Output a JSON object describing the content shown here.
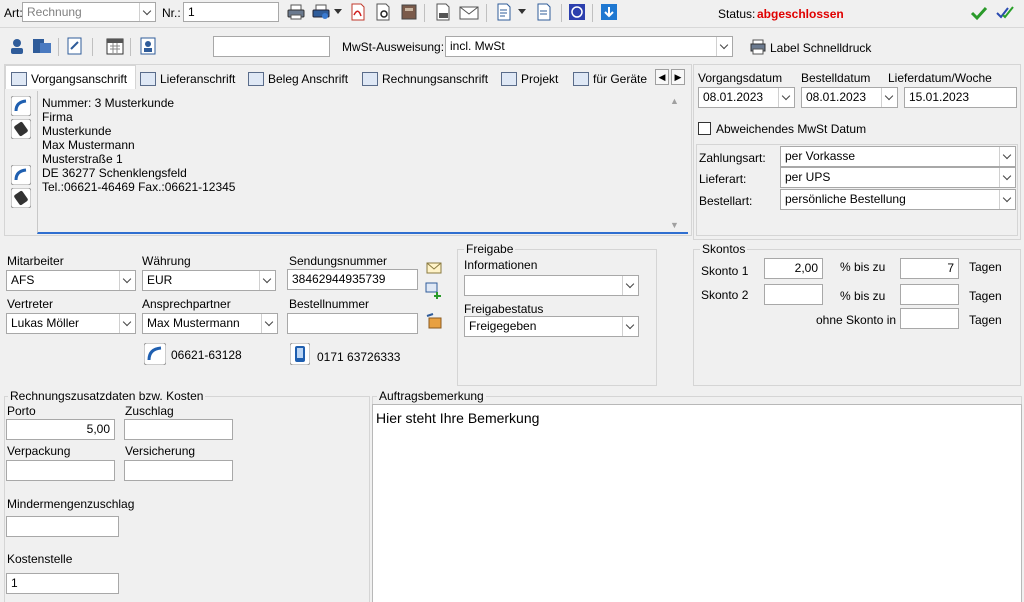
{
  "toolbar": {
    "art_label": "Art:",
    "art_value": "Rechnung",
    "nr_label": "Nr.:",
    "nr_value": "1",
    "status_label": "Status:",
    "status_value": "abgeschlossen",
    "status_color": "#e00000"
  },
  "toolbar2": {
    "mwst_label": "MwSt-Ausweisung:",
    "mwst_value": "incl. MwSt",
    "label_schnelldruck": "Label Schnelldruck"
  },
  "tabs": [
    {
      "label": "Vorgangsanschrift"
    },
    {
      "label": "Lieferanschrift"
    },
    {
      "label": "Beleg Anschrift"
    },
    {
      "label": "Rechnungsanschrift"
    },
    {
      "label": "Projekt"
    },
    {
      "label": "für Geräte"
    }
  ],
  "address": {
    "lines": [
      "Nummer: 3  Musterkunde",
      "Firma",
      "Musterkunde",
      "Max Mustermann",
      "Musterstraße 1",
      "DE 36277 Schenklengsfeld",
      "Tel.:06621-46469  Fax.:06621-12345"
    ]
  },
  "dates": {
    "vorgangsdatum_label": "Vorgangsdatum",
    "vorgangsdatum": "08.01.2023",
    "bestelldatum_label": "Bestelldatum",
    "bestelldatum": "08.01.2023",
    "lieferdatum_label": "Lieferdatum/Woche",
    "lieferdatum": "15.01.2023",
    "abw_mwst_label": "Abweichendes MwSt Datum"
  },
  "payment": {
    "zahlungsart_label": "Zahlungsart:",
    "zahlungsart": "per Vorkasse",
    "lieferart_label": "Lieferart:",
    "lieferart": "per UPS",
    "bestellart_label": "Bestellart:",
    "bestellart": "persönliche Bestellung"
  },
  "staff": {
    "mitarbeiter_label": "Mitarbeiter",
    "mitarbeiter": "AFS",
    "waehrung_label": "Währung",
    "waehrung": "EUR",
    "sendungsnummer_label": "Sendungsnummer",
    "sendungsnummer": "38462944935739",
    "vertreter_label": "Vertreter",
    "vertreter": "Lukas Möller",
    "ansprechpartner_label": "Ansprechpartner",
    "ansprechpartner": "Max Mustermann",
    "bestellnummer_label": "Bestellnummer",
    "bestellnummer": "",
    "phone": "06621-63128",
    "mobile": "0171 63726333"
  },
  "freigabe": {
    "title": "Freigabe",
    "informationen_label": "Informationen",
    "informationen": "",
    "status_label": "Freigabestatus",
    "status": "Freigegeben"
  },
  "skontos": {
    "title": "Skontos",
    "skonto1_label": "Skonto 1",
    "skonto1_value": "2,00",
    "skonto1_bis": "% bis zu",
    "skonto1_days": "7",
    "skonto1_unit": "Tagen",
    "skonto2_label": "Skonto 2",
    "skonto2_bis": "% bis zu",
    "skonto2_unit": "Tagen",
    "ohne_label": "ohne Skonto in",
    "ohne_unit": "Tagen"
  },
  "kosten": {
    "title": "Rechnungszusatzdaten bzw. Kosten",
    "porto_label": "Porto",
    "porto": "5,00",
    "zuschlag_label": "Zuschlag",
    "verpackung_label": "Verpackung",
    "versicherung_label": "Versicherung",
    "mindermengen_label": "Mindermengenzuschlag",
    "kostenstelle_label": "Kostenstelle",
    "kostenstelle": "1"
  },
  "bemerkung": {
    "title": "Auftragsbemerkung",
    "text": "Hier steht Ihre Bemerkung"
  }
}
